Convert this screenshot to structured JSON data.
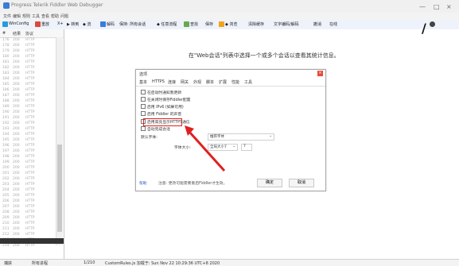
{
  "window": {
    "title": "Progress Telerik Fiddler Web Debugger",
    "controls": [
      "—",
      "□",
      "×"
    ]
  },
  "menubar": [
    "文件",
    "编辑",
    "规则",
    "工具",
    "查看",
    "帮助",
    "问题"
  ],
  "toolbar": {
    "items": [
      "WinConfig",
      "重放",
      "X+",
      "▶ 转到",
      "◆ 流",
      "解码",
      "保持: 所有会话",
      "◆ 任意流程",
      "查找",
      "保存",
      "◆ 浏览",
      "清除缓存",
      "文字编码/解码",
      "撤消",
      "在线"
    ],
    "right_icon": "user-icon"
  },
  "session_list": {
    "headers": [
      "#",
      "结果",
      "协议"
    ],
    "rows": [
      [
        "176",
        "200",
        "HTTP"
      ],
      [
        "178",
        "200",
        "HTTP"
      ],
      [
        "179",
        "200",
        "HTTP"
      ],
      [
        "180",
        "200",
        "HTTP"
      ],
      [
        "181",
        "200",
        "HTTP"
      ],
      [
        "182",
        "200",
        "HTTP"
      ],
      [
        "183",
        "200",
        "HTTP"
      ],
      [
        "184",
        "200",
        "HTTP"
      ],
      [
        "185",
        "200",
        "HTTP"
      ],
      [
        "186",
        "200",
        "HTTP"
      ],
      [
        "187",
        "200",
        "HTTP"
      ],
      [
        "188",
        "200",
        "HTTP"
      ],
      [
        "189",
        "200",
        "HTTP"
      ],
      [
        "190",
        "200",
        "HTTP"
      ],
      [
        "191",
        "200",
        "HTTP"
      ],
      [
        "192",
        "200",
        "HTTP"
      ],
      [
        "193",
        "200",
        "HTTP"
      ],
      [
        "194",
        "200",
        "HTTP"
      ],
      [
        "195",
        "200",
        "HTTP"
      ],
      [
        "196",
        "200",
        "HTTP"
      ],
      [
        "197",
        "200",
        "HTTP"
      ],
      [
        "198",
        "200",
        "HTTP"
      ],
      [
        "199",
        "200",
        "HTTP"
      ],
      [
        "200",
        "200",
        "HTTP"
      ],
      [
        "201",
        "200",
        "HTTP"
      ],
      [
        "202",
        "200",
        "HTTP"
      ],
      [
        "203",
        "200",
        "HTTP"
      ],
      [
        "204",
        "200",
        "HTTP"
      ],
      [
        "205",
        "200",
        "HTTP"
      ],
      [
        "206",
        "200",
        "HTTP"
      ],
      [
        "207",
        "200",
        "HTTP"
      ],
      [
        "208",
        "200",
        "HTTP"
      ],
      [
        "209",
        "200",
        "HTTP"
      ],
      [
        "210",
        "200",
        "HTTP"
      ],
      [
        "211",
        "200",
        "HTTP"
      ],
      [
        "212",
        "200",
        "HTTP"
      ],
      [
        "213",
        "200",
        "HTTP"
      ],
      [
        "214",
        "200",
        "HTTP"
      ]
    ]
  },
  "main": {
    "hint": "在\"Web会话\"列表中选择一个或多个会话以查看其统计信息。"
  },
  "dialog": {
    "title": "选项",
    "tabs": [
      "基本",
      "HTTPS",
      "连接",
      "网关",
      "外观",
      "脚本",
      "扩展",
      "性能",
      "工具"
    ],
    "options": [
      "在启动时通知我更新",
      "在关闭时保存Fiddler配置",
      "启用 IPv6 (如果可用)",
      "启用 Fiddler 的声音",
      "启用高亮显示HTTPS通信",
      "自动完成会话"
    ],
    "highlighted_option_index": 4,
    "font_label": "默认字体:",
    "font_value": "推荐字体",
    "size_label": "字体大小:",
    "size_value": "全局大小7",
    "size_input": "7",
    "help": "帮助",
    "note": "注意: 更改可能需要重启Fiddler才生效。",
    "ok": "确定",
    "cancel": "取消"
  },
  "statusbar": {
    "capture": "捕获",
    "all_processes": "所有进程",
    "count": "1/210",
    "message": "CustomRules.js 加载于: Sun Nov 22 10:29:36 UTC+8 2020"
  },
  "colors": {
    "highlight": "#e02020",
    "arrow": "#e02020"
  }
}
